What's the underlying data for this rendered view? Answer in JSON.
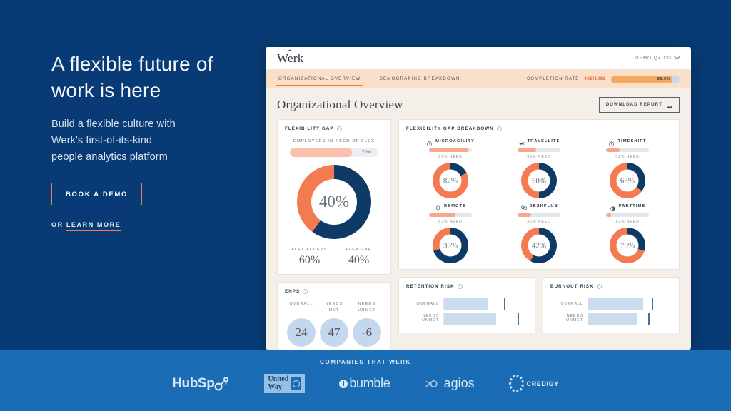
{
  "hero": {
    "title_line1": "A flexible future of",
    "title_line2": "work is here",
    "subtitle_line1": "Build a flexible culture with",
    "subtitle_line2": "Werk's first-of-its-kind",
    "subtitle_line3": "people analytics platform",
    "cta_label": "BOOK A DEMO",
    "learn_prefix": "OR ",
    "learn_label": "LEARN MORE"
  },
  "dashboard": {
    "brand": "Werk",
    "account": "DEMO QA CO",
    "tabs": [
      {
        "label": "ORGANIZATIONAL OVERVIEW",
        "active": true
      },
      {
        "label": "DEMOGRAPHIC BREAKDOWN",
        "active": false
      }
    ],
    "completion": {
      "label": "COMPLETION RATE",
      "fraction": "982/1092",
      "percent": "89.9%",
      "percent_value": 89.9
    },
    "page_title": "Organizational Overview",
    "download_label": "DOWNLOAD REPORT",
    "flexibility_gap": {
      "card_title": "FLEXIBILITY GAP",
      "bar_label": "EMPLOYEES IN NEED OF FLEX",
      "bar_percent": "70%",
      "bar_value": 70,
      "center_value": "40%",
      "legend": [
        {
          "label": "FLEX ACCESS",
          "value": "60%",
          "pct": 60,
          "color": "#0d3b66"
        },
        {
          "label": "FLEX GAP",
          "value": "40%",
          "pct": 40,
          "color": "#f47a4f"
        }
      ]
    },
    "breakdown": {
      "card_title": "FLEXIBILITY GAP BREAKDOWN",
      "items": [
        {
          "name": "MICROAGILITY",
          "icon": "clock-icon",
          "need_label": "92% NEED",
          "need": 92,
          "value": "82%",
          "pct": 82
        },
        {
          "name": "TRAVELLITE",
          "icon": "plane-icon",
          "need_label": "43% NEED",
          "need": 43,
          "value": "50%",
          "pct": 50
        },
        {
          "name": "TIMESHIFT",
          "icon": "stopwatch-icon",
          "need_label": "32% NEED",
          "need": 32,
          "value": "65%",
          "pct": 65
        },
        {
          "name": "REMOTE",
          "icon": "lamp-icon",
          "need_label": "62% NEED",
          "need": 62,
          "value": "30%",
          "pct": 30
        },
        {
          "name": "DESKPLUS",
          "icon": "desk-icon",
          "need_label": "32% NEED",
          "need": 32,
          "value": "42%",
          "pct": 42
        },
        {
          "name": "PARTTIME",
          "icon": "halfclock-icon",
          "need_label": "12% NEED",
          "need": 12,
          "value": "70%",
          "pct": 70
        }
      ]
    },
    "enps": {
      "card_title": "ENPS",
      "items": [
        {
          "label": "OVERALL",
          "value": "24"
        },
        {
          "label": "NEEDS\nMET",
          "value": "47"
        },
        {
          "label": "NEEDS\nUNMET",
          "value": "-6"
        }
      ]
    },
    "retention_risk": {
      "card_title": "RETENTION RISK",
      "rows": [
        {
          "label": "OVERALL",
          "bar": 52,
          "mark": 72
        },
        {
          "label": "NEEDS UNMET",
          "bar": 62,
          "mark": 88
        }
      ]
    },
    "burnout_risk": {
      "card_title": "BURNOUT RISK",
      "rows": [
        {
          "label": "OVERALL",
          "bar": 66,
          "mark": 76
        },
        {
          "label": "NEEDS UNMET",
          "bar": 58,
          "mark": 72
        }
      ]
    }
  },
  "footer": {
    "label": "COMPANIES THAT WERK",
    "logos": [
      {
        "name": "HubSpot",
        "text": "HubSp"
      },
      {
        "name": "United Way",
        "line1": "United",
        "line2": "Way"
      },
      {
        "name": "bumble",
        "text": "bumble"
      },
      {
        "name": "agios",
        "text": "agios"
      },
      {
        "name": "CREDIGY",
        "text": "CREDIGY"
      }
    ]
  },
  "colors": {
    "page_bg": "#083b75",
    "footer_bg": "#1a6cb5",
    "accent_orange": "#ef7d52",
    "navy": "#0d3b66",
    "dash_bg": "#f4efe9",
    "nav_bg": "#fadfc9"
  }
}
